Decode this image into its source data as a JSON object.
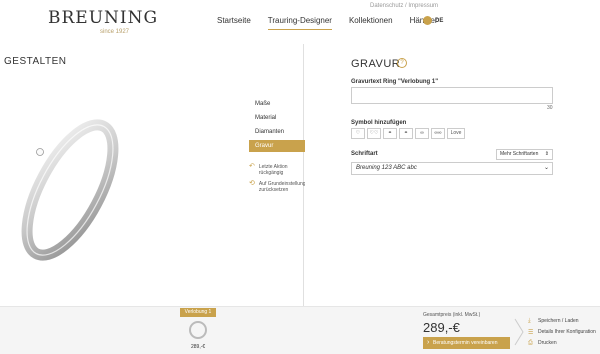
{
  "header": {
    "topline": "Datenschutz / Impressum",
    "logo": {
      "word": "BREUNING",
      "sub": "since 1927"
    },
    "nav": [
      {
        "label": "Startseite"
      },
      {
        "label": "Trauring-Designer",
        "active": true
      },
      {
        "label": "Kollektionen"
      },
      {
        "label": "Händler"
      }
    ],
    "lang": "DE"
  },
  "left": {
    "title": "GESTALTEN",
    "steps": [
      {
        "label": "Maße"
      },
      {
        "label": "Material"
      },
      {
        "label": "Diamanten"
      },
      {
        "label": "Gravur",
        "active": true
      }
    ],
    "undo": [
      {
        "icon": "undo-icon",
        "label": "Letzte Aktion rückgängig"
      },
      {
        "icon": "reset-icon",
        "label": "Auf Grundeinstellung zurücksetzen"
      }
    ]
  },
  "right": {
    "title": "GRAVUR",
    "help": "?",
    "text_label": "Gravurtext Ring \"Verlobung 1\"",
    "text_value": "",
    "counter": "30",
    "symbols_label": "Symbol hinzufügen",
    "symbols": [
      "♡",
      "♡♡",
      "⚭",
      "⚭",
      "∞",
      "∞∞",
      "Love"
    ],
    "font_label": "Schriftart",
    "more_fonts": "Mehr Schriftarten",
    "font_value": "Breuning 123 ABC abc"
  },
  "footer": {
    "ring_tag": "Verlobung 1",
    "ring_price": "289,-€",
    "total_label": "Gesamtpreis (inkl. MwSt.)",
    "total_price": "289,-€",
    "cta": "Beratungstermin vereinbaren",
    "actions": [
      {
        "icon": "save-icon",
        "label": "Speichern / Laden"
      },
      {
        "icon": "details-icon",
        "label": "Details Ihrer Konfiguration"
      },
      {
        "icon": "print-icon",
        "label": "Drucken"
      }
    ]
  },
  "colors": {
    "accent": "#c9a24c",
    "text": "#333333",
    "footer_bg": "#f5f5f5"
  }
}
